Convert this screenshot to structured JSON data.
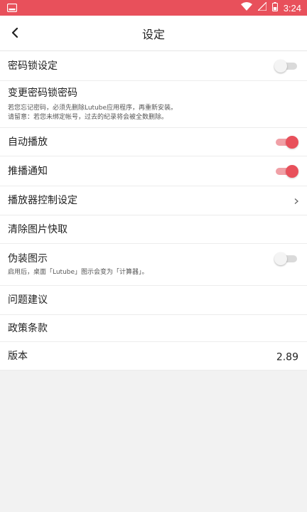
{
  "status_bar": {
    "time": "3:24",
    "bg_color": "#e8505b",
    "icons": [
      "app-notification-icon",
      "wifi-icon",
      "signal-icon",
      "battery-icon"
    ]
  },
  "header": {
    "title": "设定",
    "back_icon": "back-chevron-icon"
  },
  "settings": {
    "passcode_lock": {
      "label": "密码锁设定",
      "toggle_on": false
    },
    "change_passcode": {
      "label": "变更密码锁密码",
      "note_1": "若您忘记密码，必须先删除Lutube应用程序，再重新安装。",
      "note_2": "请留意：若您未绑定帐号，过去的纪录将会被全数删除。"
    },
    "autoplay": {
      "label": "自动播放",
      "toggle_on": true
    },
    "push_notifications": {
      "label": "推播通知",
      "toggle_on": true
    },
    "player_controls": {
      "label": "播放器控制设定",
      "chevron": "chevron-right-icon"
    },
    "clear_image_cache": {
      "label": "清除图片快取"
    },
    "disguise_icon": {
      "label": "伪装图示",
      "note": "启用后，桌面「Lutube」图示会变为「计算器」。",
      "toggle_on": false
    },
    "feedback": {
      "label": "问题建议"
    },
    "policy": {
      "label": "政策条款"
    },
    "version": {
      "label": "版本",
      "value": "2.89"
    }
  },
  "colors": {
    "accent": "#e8505b",
    "toggle_off_track": "#dadada",
    "background": "#f2f2f2"
  }
}
